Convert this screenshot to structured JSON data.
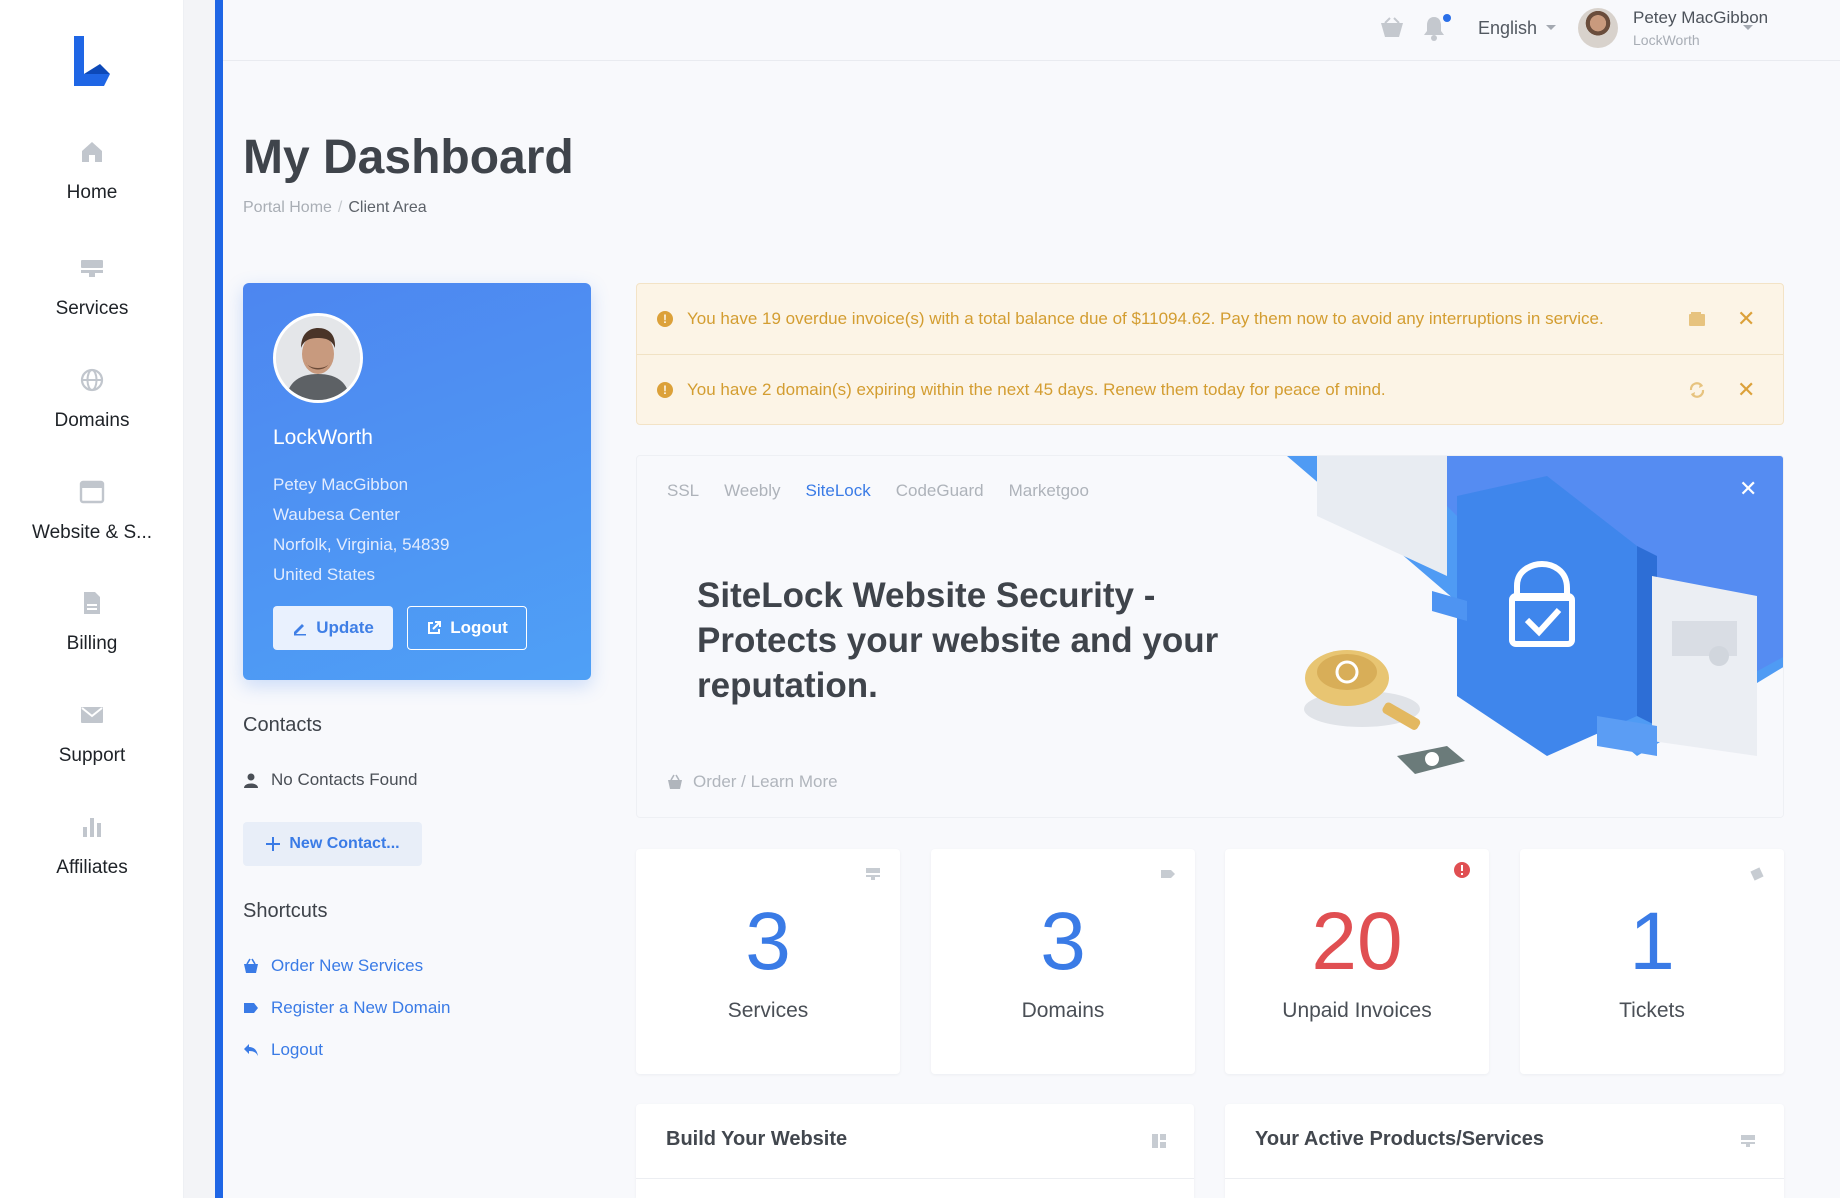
{
  "sidebar": {
    "items": [
      {
        "label": "Home",
        "icon": "home-icon"
      },
      {
        "label": "Services",
        "icon": "server-icon"
      },
      {
        "label": "Domains",
        "icon": "globe-icon"
      },
      {
        "label": "Website & S...",
        "icon": "browser-window-icon"
      },
      {
        "label": "Billing",
        "icon": "document-icon"
      },
      {
        "label": "Support",
        "icon": "envelope-icon"
      },
      {
        "label": "Affiliates",
        "icon": "bar-chart-icon"
      }
    ]
  },
  "topbar": {
    "language": "English",
    "user_name": "Petey MacGibbon",
    "user_company": "LockWorth"
  },
  "header": {
    "title": "My Dashboard",
    "breadcrumb": {
      "home": "Portal Home",
      "current": "Client Area"
    }
  },
  "profile": {
    "company": "LockWorth",
    "name": "Petey MacGibbon",
    "address1": "Waubesa Center",
    "city_line": "Norfolk, Virginia, 54839",
    "country": "United States",
    "update_label": "Update",
    "logout_label": "Logout"
  },
  "contacts": {
    "heading": "Contacts",
    "empty_text": "No Contacts Found",
    "new_label": "New Contact..."
  },
  "shortcuts": {
    "heading": "Shortcuts",
    "items": [
      {
        "label": "Order New Services",
        "icon": "basket-icon"
      },
      {
        "label": "Register a New Domain",
        "icon": "tag-icon"
      },
      {
        "label": "Logout",
        "icon": "reply-arrow-icon"
      }
    ]
  },
  "alerts": [
    {
      "text": "You have 19 overdue invoice(s) with a total balance due of $11094.62. Pay them now to avoid any interruptions in service.",
      "action_icon": "wallet-icon"
    },
    {
      "text": "You have 2 domain(s) expiring within the next 45 days. Renew them today for peace of mind.",
      "action_icon": "sync-icon"
    }
  ],
  "promo": {
    "tabs": [
      "SSL",
      "Weebly",
      "SiteLock",
      "CodeGuard",
      "Marketgoo"
    ],
    "active_tab": "SiteLock",
    "title": "SiteLock Website Security - Protects your website and your reputation.",
    "order_label": "Order / Learn More"
  },
  "stats": [
    {
      "value": "3",
      "label": "Services",
      "icon": "server-icon"
    },
    {
      "value": "3",
      "label": "Domains",
      "icon": "tag-icon"
    },
    {
      "value": "20",
      "label": "Unpaid Invoices",
      "icon": "alert-circle-icon",
      "alert": true
    },
    {
      "value": "1",
      "label": "Tickets",
      "icon": "ticket-icon"
    }
  ],
  "panels": [
    {
      "title": "Build Your Website",
      "icon": "layout-icon"
    },
    {
      "title": "Your Active Products/Services",
      "icon": "server-icon"
    }
  ],
  "colors": {
    "accent": "#3a7be6",
    "strip": "#1f66e5",
    "alert_text": "#d39d31",
    "danger": "#e04f52"
  }
}
